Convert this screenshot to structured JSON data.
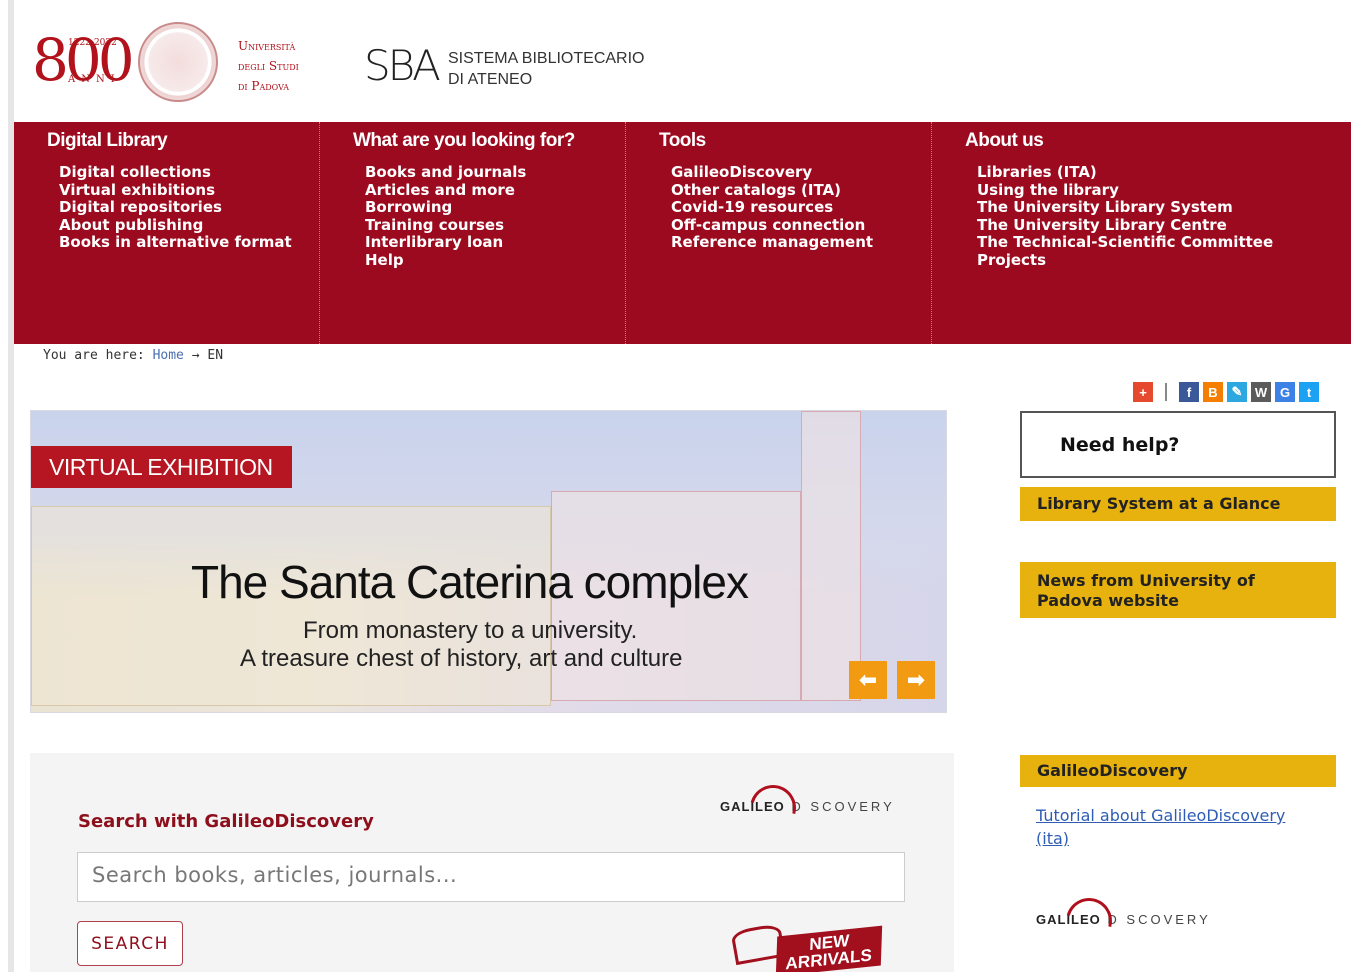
{
  "header": {
    "anniversary_years": "1222-2022",
    "anniversary_number": "800",
    "anniversary_word": "ANNI",
    "university_line1": "Università",
    "university_line2": "degli Studi",
    "university_line3": "di Padova",
    "sba_mark": "SBA",
    "sba_line1": "SISTEMA BIBLIOTECARIO",
    "sba_line2": "DI ATENEO"
  },
  "nav": {
    "columns": [
      {
        "title": "Digital Library",
        "items": [
          "Digital collections",
          "Virtual exhibitions",
          "Digital repositories",
          "About publishing",
          "Books in alternative format"
        ]
      },
      {
        "title": "What are you looking for?",
        "items": [
          "Books and journals",
          "Articles and more",
          "Borrowing",
          "Training courses",
          "Interlibrary loan",
          "Help"
        ]
      },
      {
        "title": "Tools",
        "items": [
          "GalileoDiscovery",
          "Other catalogs (ITA)",
          "Covid-19 resources",
          "Off-campus connection",
          "Reference management"
        ]
      },
      {
        "title": "About us",
        "items": [
          "Libraries (ITA)",
          "Using the library",
          "The University Library System",
          "The University Library Centre",
          "The Technical-Scientific Committee",
          "Projects"
        ]
      }
    ]
  },
  "breadcrumb": {
    "prefix": "You are here:",
    "home": "Home",
    "separator": "→",
    "current": "EN"
  },
  "social": [
    {
      "icon": "plus-share-icon",
      "glyph": "+",
      "color": "#e64a2e"
    },
    {
      "icon": "facebook-icon",
      "glyph": "f",
      "color": "#3b5998"
    },
    {
      "icon": "blogger-icon",
      "glyph": "B",
      "color": "#f57d00"
    },
    {
      "icon": "livejournal-icon",
      "glyph": "✎",
      "color": "#2da7e0"
    },
    {
      "icon": "wordpress-icon",
      "glyph": "W",
      "color": "#5b5b5b"
    },
    {
      "icon": "google-icon",
      "glyph": "G",
      "color": "#3c82e6"
    },
    {
      "icon": "twitter-icon",
      "glyph": "t",
      "color": "#1da1f2"
    }
  ],
  "slider": {
    "tag": "VIRTUAL EXHIBITION",
    "title": "The Santa Caterina complex",
    "subtitle1": "From monastery to a university.",
    "subtitle2": "A treasure chest of history, art and culture",
    "prev_glyph": "⬅",
    "next_glyph": "➡"
  },
  "search": {
    "title": "Search with GalileoDiscovery",
    "placeholder": "Search books, articles, journals...",
    "button": "SEARCH",
    "logo_bold": "GALILEO",
    "logo_rest": "D SCOVERY",
    "new_arrivals_line1": "NEW",
    "new_arrivals_line2": "ARRIVALS"
  },
  "sidebar": {
    "need_help": "Need help?",
    "box1": "Library System at a Glance",
    "box2": "News from University of Padova website",
    "box3": "GalileoDiscovery",
    "tutorial_link": "Tutorial about GalileoDiscovery (ita)",
    "logo_bold": "GALILEO",
    "logo_rest": "D SCOVERY"
  }
}
